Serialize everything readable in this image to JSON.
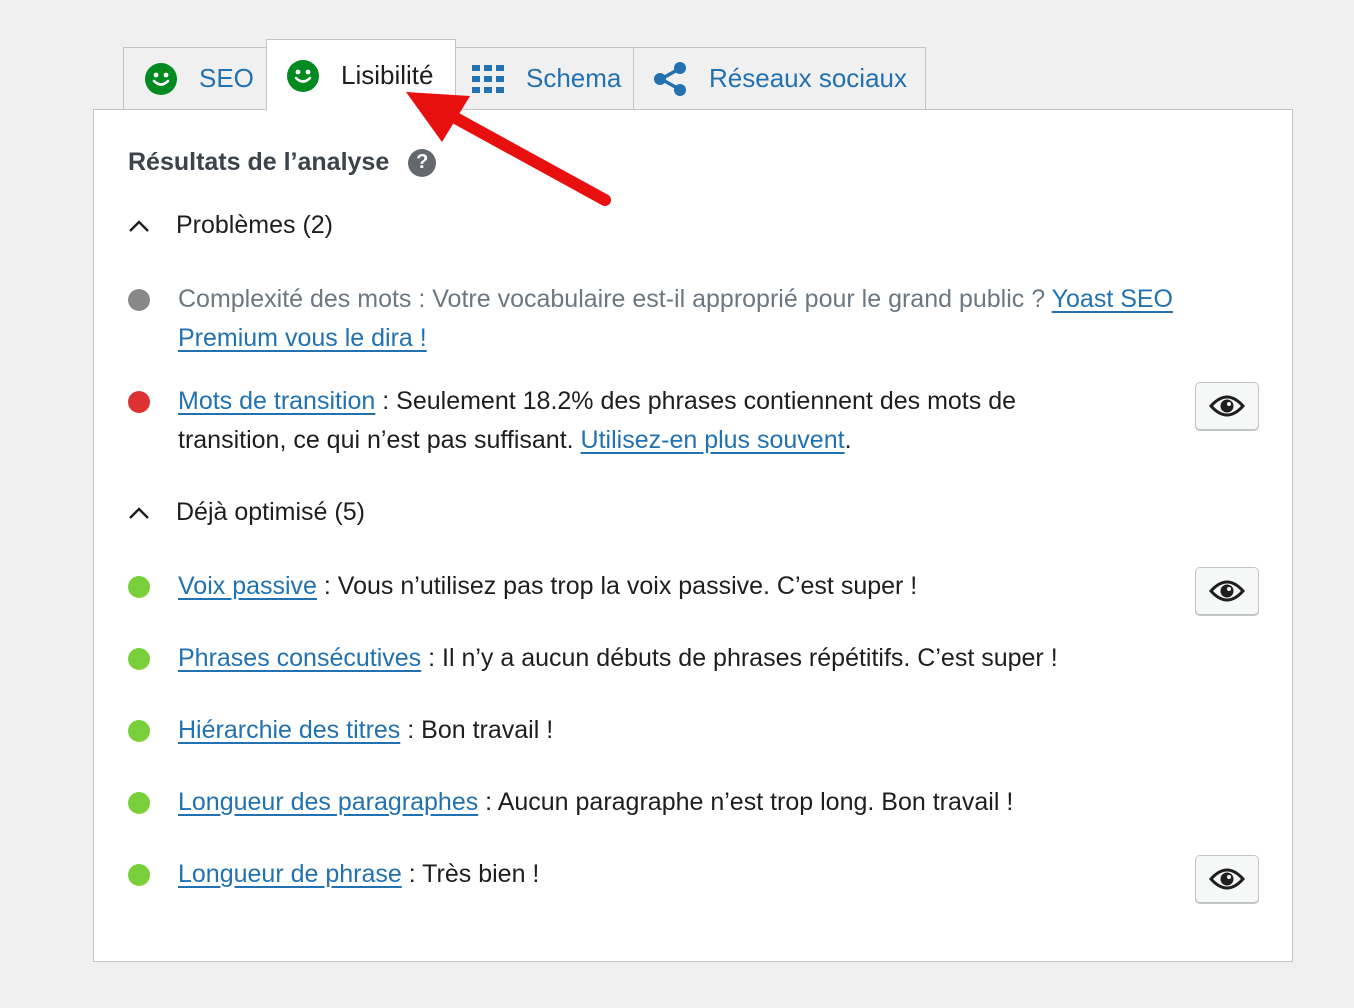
{
  "tabs": [
    {
      "label": "SEO",
      "icon": "smiley-icon"
    },
    {
      "label": "Lisibilité",
      "icon": "smiley-icon",
      "active": true
    },
    {
      "label": "Schema",
      "icon": "grid-icon"
    },
    {
      "label": "Réseaux sociaux",
      "icon": "share-icon"
    }
  ],
  "panel": {
    "heading": "Résultats de l’analyse",
    "help_glyph": "?"
  },
  "problems": {
    "title": "Problèmes (2)",
    "items": [
      {
        "status": "grey",
        "text": "Complexité des mots : Votre vocabulaire est-il approprié pour le grand public ? ",
        "link": "Yoast SEO Premium vous le dira !"
      },
      {
        "status": "red",
        "link": "Mots de transition",
        "text": " : Seulement 18.2% des phrases contiennent des mots de transition, ce qui n’est pas suffisant. ",
        "link2": "Utilisez-en plus souvent",
        "after": "."
      }
    ]
  },
  "good": {
    "title": "Déjà optimisé (5)",
    "items": [
      {
        "status": "green",
        "link": "Voix passive",
        "text": " : Vous n’utilisez pas trop la voix passive. C’est super !"
      },
      {
        "status": "green",
        "link": "Phrases consécutives",
        "text": " : Il n’y a aucun débuts de phrases répétitifs. C’est super !"
      },
      {
        "status": "green",
        "link": "Hiérarchie des titres",
        "text": " : Bon travail !"
      },
      {
        "status": "green",
        "link": "Longueur des paragraphes",
        "text": " : Aucun paragraphe n’est trop long. Bon travail !"
      },
      {
        "status": "green",
        "link": "Longueur de phrase",
        "text": " : Très bien !"
      }
    ]
  },
  "colors": {
    "green": "#7ad03a",
    "red": "#dc3232",
    "grey": "#888888",
    "link": "#2271b1",
    "smiley": "#008a20",
    "arrow": "#e8100f"
  }
}
